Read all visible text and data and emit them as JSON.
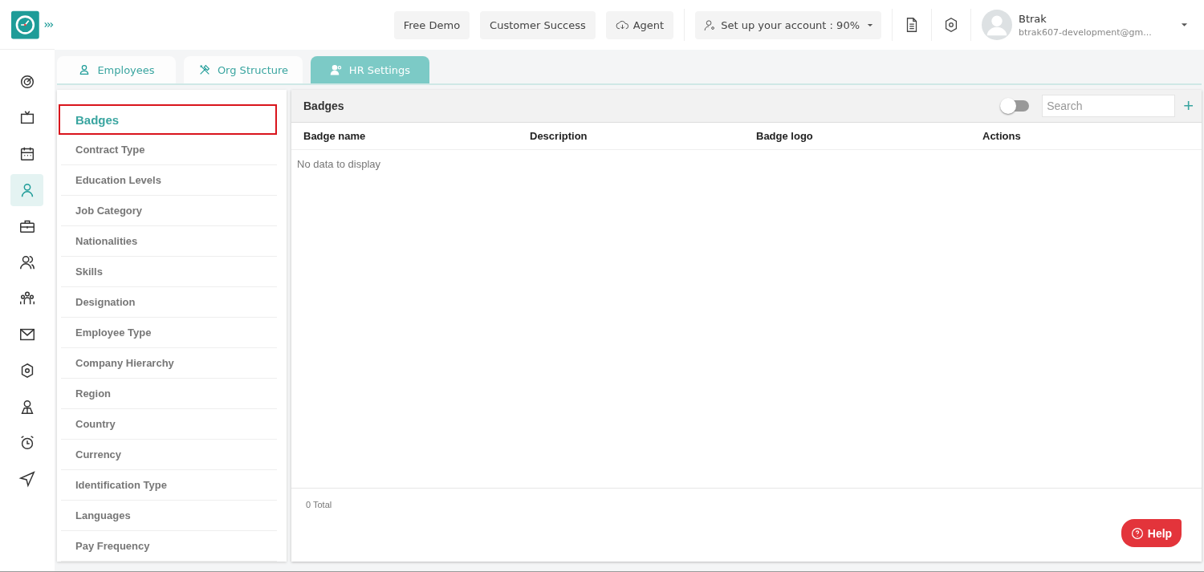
{
  "header": {
    "buttons": [
      "Free Demo",
      "Customer Success",
      "Agent"
    ],
    "setup": "Set up your account : 90%",
    "user": {
      "name": "Btrak",
      "email": "btrak607-development@gm..."
    }
  },
  "nav": [
    {
      "selected": false
    },
    {
      "selected": false
    },
    {
      "selected": false
    },
    {
      "selected": true
    },
    {
      "selected": false
    },
    {
      "selected": false
    },
    {
      "selected": false
    },
    {
      "selected": false
    },
    {
      "selected": false
    },
    {
      "selected": false
    },
    {
      "selected": false
    },
    {
      "selected": false
    }
  ],
  "tabs": [
    {
      "label": "Employees",
      "selected": false
    },
    {
      "label": "Org Structure",
      "selected": false
    },
    {
      "label": "HR Settings",
      "selected": true
    }
  ],
  "settings_menu": [
    {
      "label": "Badges",
      "selected": true
    },
    {
      "label": "Contract Type",
      "selected": false
    },
    {
      "label": "Education Levels",
      "selected": false
    },
    {
      "label": "Job Category",
      "selected": false
    },
    {
      "label": "Nationalities",
      "selected": false
    },
    {
      "label": "Skills",
      "selected": false
    },
    {
      "label": "Designation",
      "selected": false
    },
    {
      "label": "Employee Type",
      "selected": false
    },
    {
      "label": "Company Hierarchy",
      "selected": false
    },
    {
      "label": "Region",
      "selected": false
    },
    {
      "label": "Country",
      "selected": false
    },
    {
      "label": "Currency",
      "selected": false
    },
    {
      "label": "Identification Type",
      "selected": false
    },
    {
      "label": "Languages",
      "selected": false
    },
    {
      "label": "Pay Frequency",
      "selected": false
    }
  ],
  "panel": {
    "title": "Badges",
    "toggle": {
      "on": false
    },
    "search": {
      "placeholder": "Search"
    },
    "add": "+",
    "columns": [
      "Badge name",
      "Description",
      "Badge logo",
      "Actions"
    ],
    "empty": "No data to display",
    "total": "0 Total"
  },
  "help": "Help"
}
